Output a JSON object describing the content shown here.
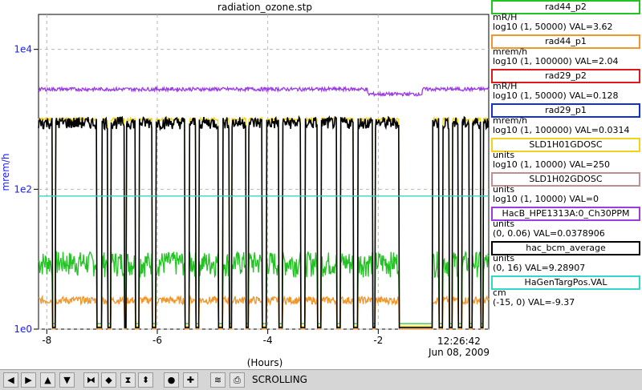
{
  "chart_data": {
    "type": "line",
    "title": "radiation_ozone.stp",
    "xlabel": "(Hours)",
    "ylabel": "mrem/h",
    "y_scale": "log",
    "xlim": [
      -8.15,
      0
    ],
    "ylim_log10": [
      0,
      4.5
    ],
    "x_ticks": [
      "-8",
      "-6",
      "-4",
      "-2"
    ],
    "y_ticks": [
      "1e0",
      "1e2",
      "1e4"
    ],
    "time_label": "12:26:42",
    "date_label": "Jun 08, 2009",
    "grid": true,
    "series": [
      {
        "name": "rad44_p2",
        "color": "#22c322",
        "baseline": 5.5,
        "high": 30,
        "style": "drop-sync"
      },
      {
        "name": "rad44_p1",
        "color": "#f0962a",
        "baseline": 2.6,
        "style": "flat-noisy"
      },
      {
        "name": "rad29_p2",
        "color": "#e01818",
        "value": 0.128,
        "style": "hidden"
      },
      {
        "name": "rad29_p1",
        "color": "#1030d0",
        "value": 0.0314,
        "style": "hidden"
      },
      {
        "name": "SLD1H01GDOSC",
        "color": "#f2d21a",
        "baseline": 1000,
        "style": "drop-sync"
      },
      {
        "name": "SLD1H02GDOSC",
        "color": "#c09090",
        "value": 0,
        "style": "hidden"
      },
      {
        "name": "HacB_HPE1313A:0_Ch30PPM",
        "color": "#9a3ce6",
        "baseline": 2700,
        "style": "noisy"
      },
      {
        "name": "hac_bcm_average",
        "color": "#000000",
        "baseline": 900,
        "style": "drop-beam"
      },
      {
        "name": "HaGenTargPos.VAL",
        "color": "#30d8c8",
        "baseline": 80,
        "style": "flat"
      }
    ]
  },
  "legend": [
    {
      "name": "rad44_p2",
      "color": "#22c322",
      "unit": "mR/H",
      "info": "log10 (1, 50000) VAL=3.62"
    },
    {
      "name": "rad44_p1",
      "color": "#f0962a",
      "unit": "mrem/h",
      "info": "log10 (1, 100000) VAL=2.04"
    },
    {
      "name": "rad29_p2",
      "color": "#e01818",
      "unit": "mR/H",
      "info": "log10 (1, 50000) VAL=0.128"
    },
    {
      "name": "rad29_p1",
      "color": "#1030d0",
      "unit": "mrem/h",
      "info": "log10 (1, 100000) VAL=0.0314"
    },
    {
      "name": "SLD1H01GDOSC",
      "color": "#f2d21a",
      "unit": "units",
      "info": "log10 (1, 10000) VAL=250"
    },
    {
      "name": "SLD1H02GDOSC",
      "color": "#c09090",
      "unit": "units",
      "info": "log10 (1, 10000) VAL=0"
    },
    {
      "name": "HacB_HPE1313A:0_Ch30PPM",
      "color": "#9a3ce6",
      "unit": "units",
      "info": "(0, 0.06) VAL=0.0378906"
    },
    {
      "name": "hac_bcm_average",
      "color": "#000000",
      "unit": "units",
      "info": "(0, 16) VAL=9.28907"
    },
    {
      "name": "HaGenTargPos.VAL",
      "color": "#30d8c8",
      "unit": "cm",
      "info": "(-15, 0) VAL=-9.37"
    }
  ],
  "toolbar": {
    "buttons": [
      {
        "name": "scroll-left-button",
        "icon": "arrow-left-icon",
        "glyph": "◀"
      },
      {
        "name": "scroll-right-button",
        "icon": "arrow-right-icon",
        "glyph": "▶"
      },
      {
        "name": "scroll-up-button",
        "icon": "arrow-up-icon",
        "glyph": "▲"
      },
      {
        "name": "scroll-down-button",
        "icon": "arrow-down-icon",
        "glyph": "▼"
      },
      {
        "name": "zoom-in-x-button",
        "icon": "zoom-in-x-icon",
        "glyph": "⧓"
      },
      {
        "name": "zoom-out-x-button",
        "icon": "zoom-out-x-icon",
        "glyph": "◆"
      },
      {
        "name": "zoom-in-y-button",
        "icon": "zoom-in-y-icon",
        "glyph": "⧗"
      },
      {
        "name": "zoom-out-y-button",
        "icon": "zoom-out-y-icon",
        "glyph": "⬍"
      },
      {
        "name": "autoscale-button",
        "icon": "autoscale-icon",
        "glyph": "●"
      },
      {
        "name": "crosshair-button",
        "icon": "crosshair-icon",
        "glyph": "✚"
      },
      {
        "name": "config-button",
        "icon": "config-icon",
        "glyph": "≋"
      },
      {
        "name": "print-button",
        "icon": "print-icon",
        "glyph": "⎙"
      }
    ],
    "status": "SCROLLING"
  }
}
